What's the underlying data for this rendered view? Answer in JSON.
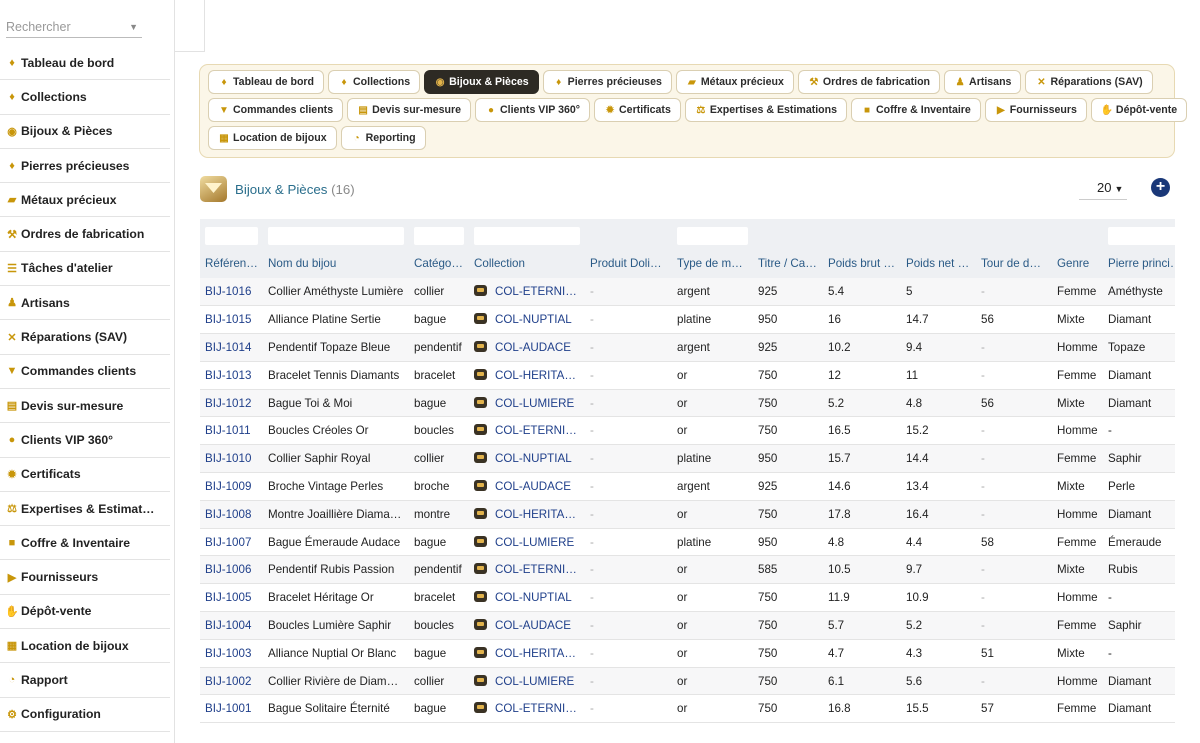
{
  "sidebar": {
    "search_placeholder": "Rechercher",
    "items": [
      {
        "label": "Tableau de bord",
        "icon": "gem-icon"
      },
      {
        "label": "Collections",
        "icon": "gem-icon"
      },
      {
        "label": "Bijoux & Pièces",
        "icon": "ring-icon"
      },
      {
        "label": "Pierres précieuses",
        "icon": "gem-icon"
      },
      {
        "label": "Métaux précieux",
        "icon": "gold-bars-icon"
      },
      {
        "label": "Ordres de fabrication",
        "icon": "hammer-icon"
      },
      {
        "label": "Tâches d'atelier",
        "icon": "list-icon"
      },
      {
        "label": "Artisans",
        "icon": "users-icon"
      },
      {
        "label": "Réparations (SAV)",
        "icon": "tools-icon"
      },
      {
        "label": "Commandes clients",
        "icon": "cart-icon"
      },
      {
        "label": "Devis sur-mesure",
        "icon": "document-icon"
      },
      {
        "label": "Clients VIP 360°",
        "icon": "user-icon"
      },
      {
        "label": "Certificats",
        "icon": "certificate-icon"
      },
      {
        "label": "Expertises & Estimat…",
        "icon": "scale-icon"
      },
      {
        "label": "Coffre & Inventaire",
        "icon": "lock-icon"
      },
      {
        "label": "Fournisseurs",
        "icon": "truck-icon"
      },
      {
        "label": "Dépôt-vente",
        "icon": "handshake-icon"
      },
      {
        "label": "Location de bijoux",
        "icon": "calendar-icon"
      },
      {
        "label": "Rapport",
        "icon": "chart-icon"
      },
      {
        "label": "Configuration",
        "icon": "gear-icon"
      }
    ]
  },
  "tabs": {
    "rows": [
      [
        {
          "label": "Tableau de bord",
          "icon": "gem-icon"
        },
        {
          "label": "Collections",
          "icon": "gem-icon"
        },
        {
          "label": "Bijoux & Pièces",
          "icon": "ring-icon",
          "active": true
        },
        {
          "label": "Pierres précieuses",
          "icon": "gem-icon"
        },
        {
          "label": "Métaux précieux",
          "icon": "gold-bars-icon"
        },
        {
          "label": "Ordres de fabrication",
          "icon": "hammer-icon"
        },
        {
          "label": "Artisans",
          "icon": "users-icon"
        },
        {
          "label": "Réparations (SAV)",
          "icon": "tools-icon"
        }
      ],
      [
        {
          "label": "Commandes clients",
          "icon": "cart-icon"
        },
        {
          "label": "Devis sur-mesure",
          "icon": "document-icon"
        },
        {
          "label": "Clients VIP 360°",
          "icon": "user-icon"
        },
        {
          "label": "Certificats",
          "icon": "certificate-icon"
        },
        {
          "label": "Expertises & Estimations",
          "icon": "scale-icon"
        },
        {
          "label": "Coffre & Inventaire",
          "icon": "lock-icon"
        },
        {
          "label": "Fournisseurs",
          "icon": "truck-icon"
        },
        {
          "label": "Dépôt-vente",
          "icon": "handshake-icon"
        }
      ],
      [
        {
          "label": "Location de bijoux",
          "icon": "calendar-icon"
        },
        {
          "label": "Reporting",
          "icon": "chart-icon"
        }
      ]
    ]
  },
  "page": {
    "title": "Bijoux & Pièces",
    "count": "(16)",
    "page_size": "20",
    "add_icon": "plus-circle-icon"
  },
  "colors": {
    "accent_gold": "#c8960a",
    "active_tab": "#2d2a24",
    "link_blue": "#1f3f8a",
    "header_text": "#2a5a86",
    "add_button": "#1a3878"
  },
  "table": {
    "filters": [
      true,
      true,
      true,
      true,
      false,
      true,
      false,
      false,
      false,
      false,
      false,
      true
    ],
    "columns": [
      "Référence",
      "Nom du bijou",
      "Catégorie",
      "Collection",
      "Produit Dolib…",
      "Type de métal",
      "Titre / Carat",
      "Poids brut (g)",
      "Poids net (g)",
      "Tour de doigt",
      "Genre",
      "Pierre princi…"
    ],
    "rows": [
      [
        "BIJ-1016",
        "Collier Améthyste Lumière",
        "collier",
        "COL-ETERNITE",
        "-",
        "argent",
        "925",
        "5.4",
        "5",
        "-",
        "Femme",
        "Améthyste"
      ],
      [
        "BIJ-1015",
        "Alliance Platine Sertie",
        "bague",
        "COL-NUPTIAL",
        "-",
        "platine",
        "950",
        "16",
        "14.7",
        "56",
        "Mixte",
        "Diamant"
      ],
      [
        "BIJ-1014",
        "Pendentif Topaze Bleue",
        "pendentif",
        "COL-AUDACE",
        "-",
        "argent",
        "925",
        "10.2",
        "9.4",
        "-",
        "Homme",
        "Topaze"
      ],
      [
        "BIJ-1013",
        "Bracelet Tennis Diamants",
        "bracelet",
        "COL-HERITAGE",
        "-",
        "or",
        "750",
        "12",
        "11",
        "-",
        "Femme",
        "Diamant"
      ],
      [
        "BIJ-1012",
        "Bague Toi & Moi",
        "bague",
        "COL-LUMIERE",
        "-",
        "or",
        "750",
        "5.2",
        "4.8",
        "56",
        "Mixte",
        "Diamant"
      ],
      [
        "BIJ-1011",
        "Boucles Créoles Or",
        "boucles",
        "COL-ETERNITE",
        "-",
        "or",
        "750",
        "16.5",
        "15.2",
        "-",
        "Homme",
        "-"
      ],
      [
        "BIJ-1010",
        "Collier Saphir Royal",
        "collier",
        "COL-NUPTIAL",
        "-",
        "platine",
        "950",
        "15.7",
        "14.4",
        "-",
        "Femme",
        "Saphir"
      ],
      [
        "BIJ-1009",
        "Broche Vintage Perles",
        "broche",
        "COL-AUDACE",
        "-",
        "argent",
        "925",
        "14.6",
        "13.4",
        "-",
        "Mixte",
        "Perle"
      ],
      [
        "BIJ-1008",
        "Montre Joaillière Diamants",
        "montre",
        "COL-HERITAGE",
        "-",
        "or",
        "750",
        "17.8",
        "16.4",
        "-",
        "Homme",
        "Diamant"
      ],
      [
        "BIJ-1007",
        "Bague Émeraude Audace",
        "bague",
        "COL-LUMIERE",
        "-",
        "platine",
        "950",
        "4.8",
        "4.4",
        "58",
        "Femme",
        "Émeraude"
      ],
      [
        "BIJ-1006",
        "Pendentif Rubis Passion",
        "pendentif",
        "COL-ETERNITE",
        "-",
        "or",
        "585",
        "10.5",
        "9.7",
        "-",
        "Mixte",
        "Rubis"
      ],
      [
        "BIJ-1005",
        "Bracelet Héritage Or",
        "bracelet",
        "COL-NUPTIAL",
        "-",
        "or",
        "750",
        "11.9",
        "10.9",
        "-",
        "Homme",
        "-"
      ],
      [
        "BIJ-1004",
        "Boucles Lumière Saphir",
        "boucles",
        "COL-AUDACE",
        "-",
        "or",
        "750",
        "5.7",
        "5.2",
        "-",
        "Femme",
        "Saphir"
      ],
      [
        "BIJ-1003",
        "Alliance Nuptial Or Blanc",
        "bague",
        "COL-HERITAGE",
        "-",
        "or",
        "750",
        "4.7",
        "4.3",
        "51",
        "Mixte",
        "-"
      ],
      [
        "BIJ-1002",
        "Collier Rivière de Diamants",
        "collier",
        "COL-LUMIERE",
        "-",
        "or",
        "750",
        "6.1",
        "5.6",
        "-",
        "Homme",
        "Diamant"
      ],
      [
        "BIJ-1001",
        "Bague Solitaire Éternité",
        "bague",
        "COL-ETERNITE",
        "-",
        "or",
        "750",
        "16.8",
        "15.5",
        "57",
        "Femme",
        "Diamant"
      ]
    ]
  }
}
